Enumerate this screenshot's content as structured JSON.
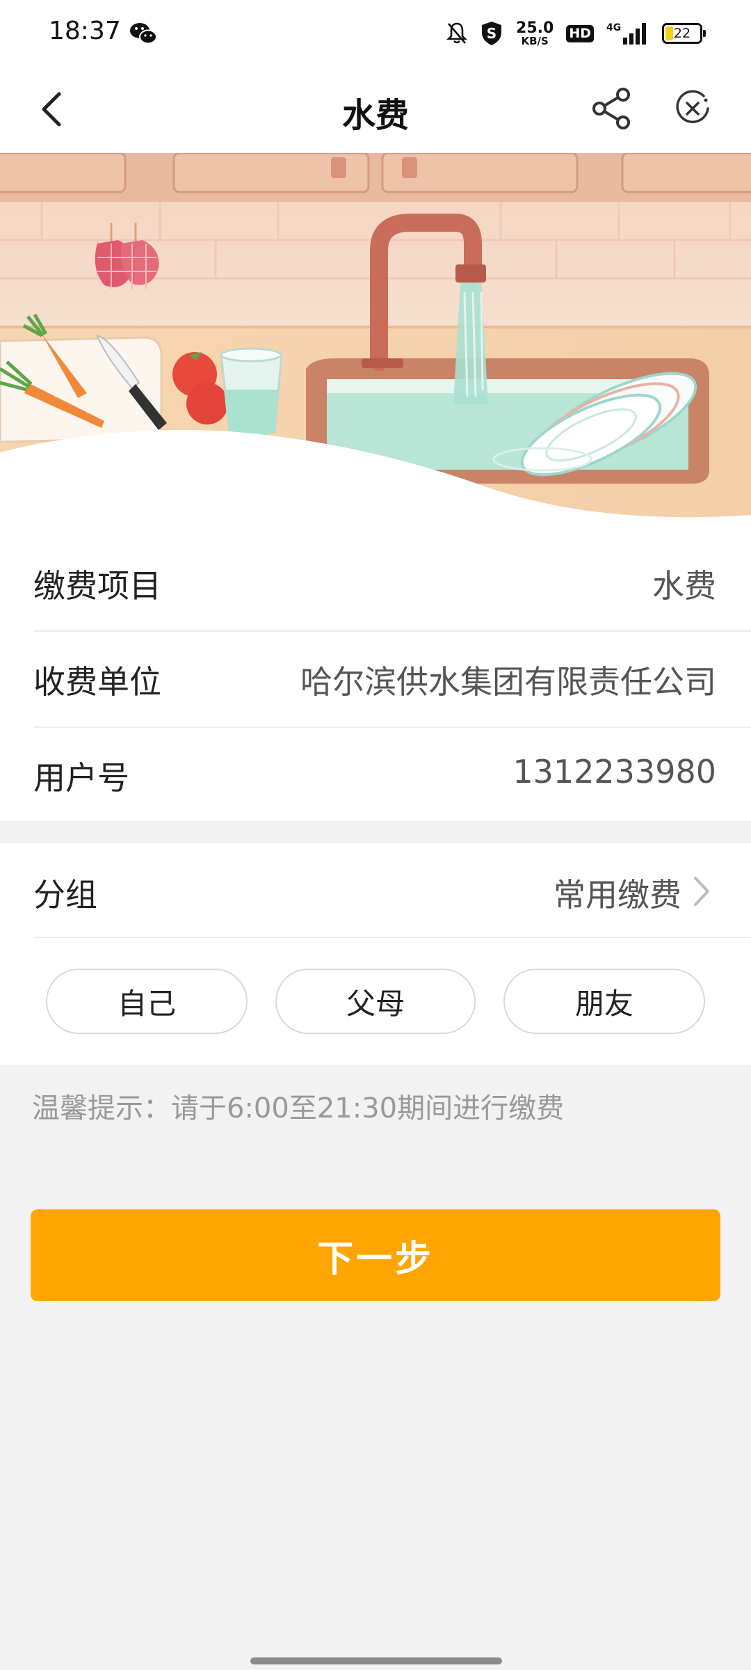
{
  "status_bar": {
    "time": "18:37",
    "net_speed_value": "25.0",
    "net_speed_unit": "KB/S",
    "hd_label": "HD",
    "network_label": "4G",
    "battery_level": "22",
    "icons": [
      "wechat-icon",
      "mute-bell-icon",
      "shield-icon",
      "signal-icon",
      "battery-icon"
    ]
  },
  "header": {
    "title": "水费",
    "icons": [
      "back-arrow-icon",
      "share-icon",
      "close-circle-icon"
    ]
  },
  "info": {
    "rows": [
      {
        "label": "缴费项目",
        "value": "水费"
      },
      {
        "label": "收费单位",
        "value": "哈尔滨供水集团有限责任公司"
      },
      {
        "label": "用户号",
        "value": "1312233980"
      }
    ]
  },
  "group": {
    "label": "分组",
    "value": "常用缴费",
    "chips": [
      "自己",
      "父母",
      "朋友"
    ]
  },
  "hint": "温馨提示：请于6:00至21:30期间进行缴费",
  "next_button": "下一步",
  "colors": {
    "accent": "#fea502",
    "background": "#f2f2f2"
  }
}
